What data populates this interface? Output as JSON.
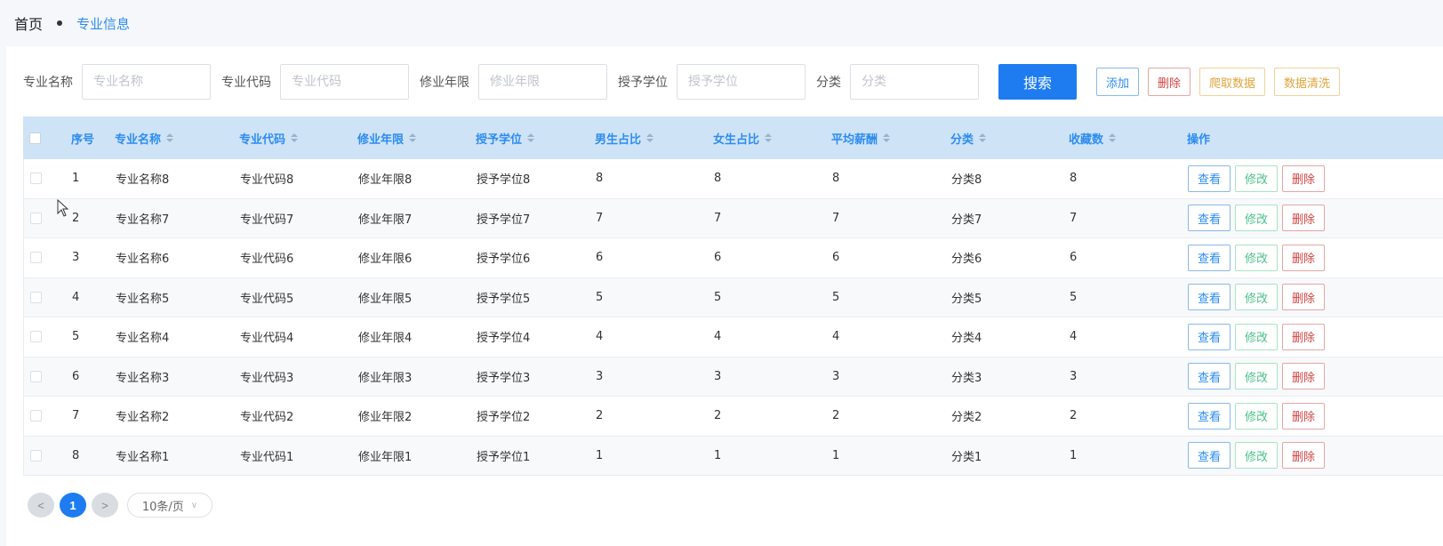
{
  "breadcrumb": {
    "home": "首页",
    "current": "专业信息"
  },
  "filters": [
    {
      "label": "专业名称",
      "placeholder": "专业名称"
    },
    {
      "label": "专业代码",
      "placeholder": "专业代码"
    },
    {
      "label": "修业年限",
      "placeholder": "修业年限"
    },
    {
      "label": "授予学位",
      "placeholder": "授予学位"
    },
    {
      "label": "分类",
      "placeholder": "分类"
    }
  ],
  "toolbar": {
    "search_label": "搜索",
    "add_label": "添加",
    "delete_label": "删除",
    "crawl_label": "爬取数据",
    "clean_label": "数据清洗"
  },
  "table": {
    "headers": [
      "序号",
      "专业名称",
      "专业代码",
      "修业年限",
      "授予学位",
      "男生占比",
      "女生占比",
      "平均薪酬",
      "分类",
      "收藏数",
      "操作"
    ],
    "rows": [
      [
        "1",
        "专业名称8",
        "专业代码8",
        "修业年限8",
        "授予学位8",
        "8",
        "8",
        "8",
        "分类8",
        "8"
      ],
      [
        "2",
        "专业名称7",
        "专业代码7",
        "修业年限7",
        "授予学位7",
        "7",
        "7",
        "7",
        "分类7",
        "7"
      ],
      [
        "3",
        "专业名称6",
        "专业代码6",
        "修业年限6",
        "授予学位6",
        "6",
        "6",
        "6",
        "分类6",
        "6"
      ],
      [
        "4",
        "专业名称5",
        "专业代码5",
        "修业年限5",
        "授予学位5",
        "5",
        "5",
        "5",
        "分类5",
        "5"
      ],
      [
        "5",
        "专业名称4",
        "专业代码4",
        "修业年限4",
        "授予学位4",
        "4",
        "4",
        "4",
        "分类4",
        "4"
      ],
      [
        "6",
        "专业名称3",
        "专业代码3",
        "修业年限3",
        "授予学位3",
        "3",
        "3",
        "3",
        "分类3",
        "3"
      ],
      [
        "7",
        "专业名称2",
        "专业代码2",
        "修业年限2",
        "授予学位2",
        "2",
        "2",
        "2",
        "分类2",
        "2"
      ],
      [
        "8",
        "专业名称1",
        "专业代码1",
        "修业年限1",
        "授予学位1",
        "1",
        "1",
        "1",
        "分类1",
        "1"
      ]
    ],
    "row_actions": {
      "view": "查看",
      "edit": "修改",
      "delete": "删除"
    }
  },
  "pagination": {
    "prev": "<",
    "current_page": "1",
    "next": ">",
    "page_size": "10条/页"
  },
  "colors": {
    "primary": "#1e7cf0",
    "header_bg": "#cfe3f7",
    "danger": "#d14343",
    "success": "#4bc08a",
    "warning": "#e0a43c"
  }
}
